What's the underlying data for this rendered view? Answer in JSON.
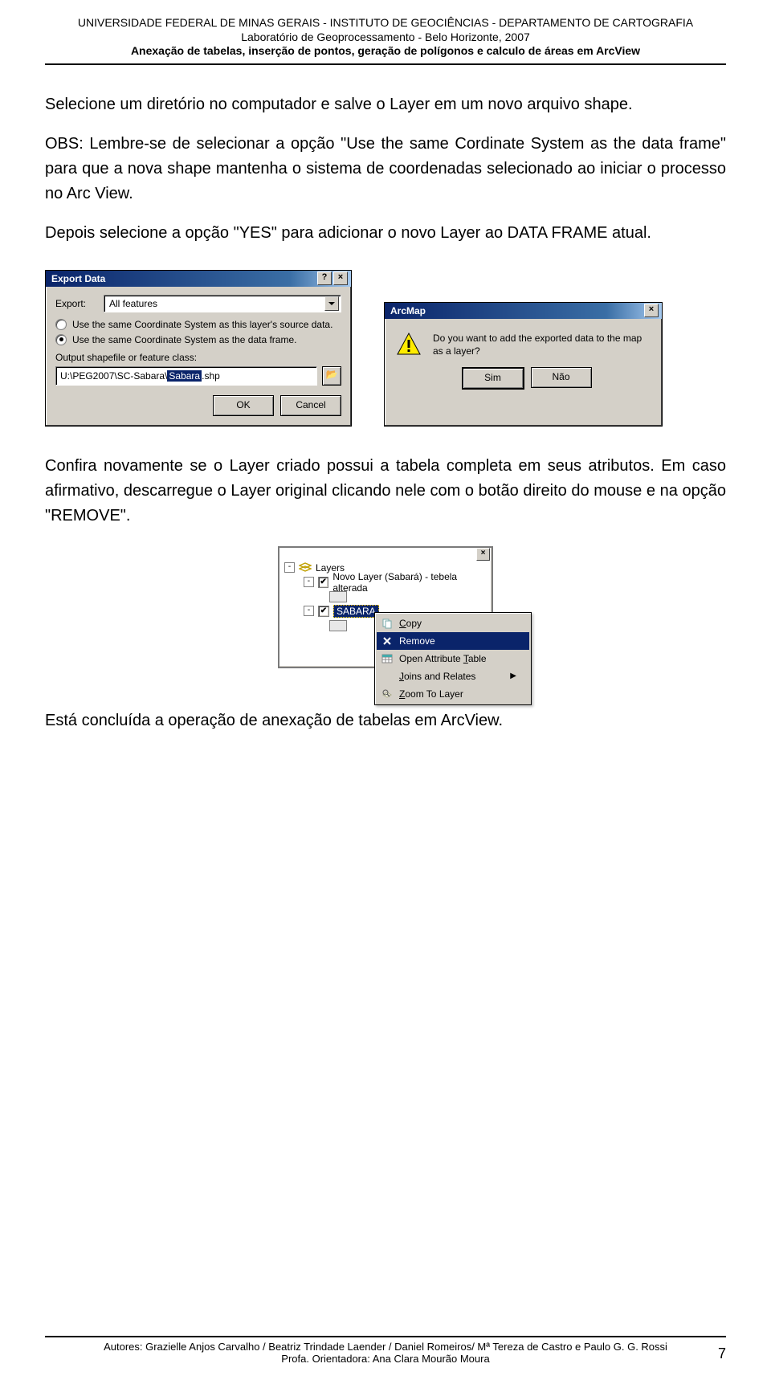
{
  "header": {
    "line1": "UNIVERSIDADE FEDERAL DE MINAS GERAIS - INSTITUTO DE GEOCIÊNCIAS - DEPARTAMENTO DE CARTOGRAFIA",
    "line2": "Laboratório de Geoprocessamento - Belo Horizonte, 2007",
    "line3": "Anexação de tabelas, inserção de pontos, geração de polígonos e calculo de áreas em ArcView"
  },
  "para1": "Selecione um diretório no computador e salve o Layer em um novo arquivo shape.",
  "para2": "OBS: Lembre-se de selecionar a opção \"Use the same Cordinate System as the data frame\" para que a nova shape mantenha o sistema de coordenadas selecionado ao iniciar o processo no Arc View.",
  "para3": "Depois selecione a opção \"YES\" para adicionar o novo Layer ao DATA FRAME atual.",
  "exportDialog": {
    "title": "Export Data",
    "help": "?",
    "close": "×",
    "exportLabel": "Export:",
    "exportValue": "All features",
    "radio1": "Use the same Coordinate System as this layer's source data.",
    "radio2": "Use the same Coordinate System as the data frame.",
    "outputLabel": "Output shapefile or feature class:",
    "pathPrefix": "U:\\PEG2007\\SC-Sabara\\",
    "pathSel": "Sabara",
    "pathSuffix": ".shp",
    "browse": "📂",
    "ok": "OK",
    "cancel": "Cancel"
  },
  "msgbox": {
    "title": "ArcMap",
    "close": "×",
    "text": "Do you want to add the exported data to the map as a layer?",
    "yes": "Sim",
    "no": "Não"
  },
  "para4": "Confira novamente se o Layer criado possui a tabela completa em seus atributos. Em caso afirmativo, descarregue o Layer original clicando nele com o botão direito do mouse e na opção \"REMOVE\".",
  "toc": {
    "close": "×",
    "layersLabel": "Layers",
    "layer1": "Novo Layer (Sabará) - tebela alterada",
    "layer2": "SABARA",
    "menu": {
      "copy": "Copy",
      "remove": "Remove",
      "openTable": "Open Attribute Table",
      "joins": "Joins and Relates",
      "zoom": "Zoom To Layer"
    }
  },
  "para5": "Está concluída a operação de anexação de tabelas em ArcView.",
  "footer": {
    "authors": "Autores: Grazielle Anjos Carvalho / Beatriz Trindade Laender / Daniel Romeiros/ Mª Tereza de Castro e Paulo G. G. Rossi",
    "orient": "Profa. Orientadora: Ana Clara Mourão Moura",
    "page": "7"
  }
}
